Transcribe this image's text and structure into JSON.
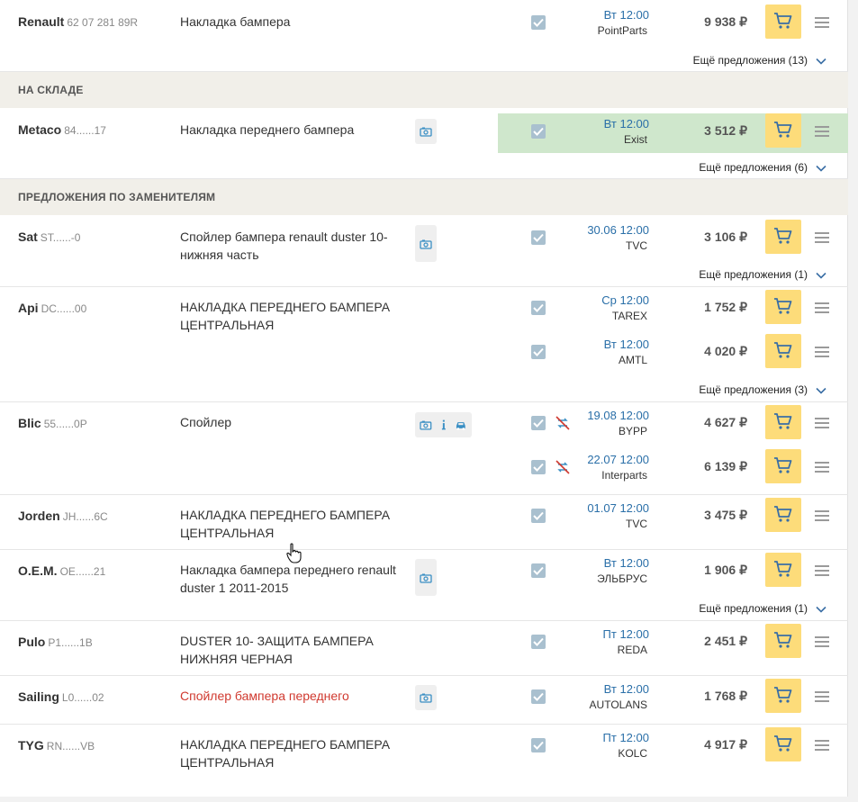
{
  "sections": {
    "in_stock": "НА СКЛАДЕ",
    "substitutes": "ПРЕДЛОЖЕНИЯ ПО ЗАМЕНИТЕЛЯМ"
  },
  "more_label_prefix": "Ещё предложения",
  "products": [
    {
      "brand": "Renault",
      "code": "62 07 281 89R",
      "desc": "Накладка бампера",
      "more": "Ещё предложения (13)",
      "offers": [
        {
          "date": "Вт 12:00",
          "supplier": "PointParts",
          "price": "9 938 ₽"
        }
      ]
    },
    {
      "brand": "Metaco",
      "code": "84......17",
      "desc": "Накладка переднего бампера",
      "more": "Ещё предложения (6)",
      "offers": [
        {
          "date": "Вт 12:00",
          "supplier": "Exist",
          "price": "3 512 ₽"
        }
      ]
    },
    {
      "brand": "Sat",
      "code": "ST......-0",
      "desc": "Спойлер бампера renault duster 10- нижняя часть",
      "more": "Ещё предложения (1)",
      "offers": [
        {
          "date": "30.06 12:00",
          "supplier": "TVC",
          "price": "3 106 ₽"
        }
      ]
    },
    {
      "brand": "Api",
      "code": "DC......00",
      "desc": "НАКЛАДКА ПЕРЕДНЕГО БАМПЕРА ЦЕНТРАЛЬНАЯ",
      "more": "Ещё предложения (3)",
      "offers": [
        {
          "date": "Ср 12:00",
          "supplier": "TAREX",
          "price": "1 752 ₽"
        },
        {
          "date": "Вт 12:00",
          "supplier": "AMTL",
          "price": "4 020 ₽"
        }
      ]
    },
    {
      "brand": "Blic",
      "code": "55......0P",
      "desc": "Спойлер",
      "offers": [
        {
          "date": "19.08 12:00",
          "supplier": "BYPP",
          "price": "4 627 ₽"
        },
        {
          "date": "22.07 12:00",
          "supplier": "Interparts",
          "price": "6 139 ₽"
        }
      ]
    },
    {
      "brand": "Jorden",
      "code": "JH......6C",
      "desc": "НАКЛАДКА ПЕРЕДНЕГО БАМПЕРА ЦЕНТРАЛЬНАЯ",
      "offers": [
        {
          "date": "01.07 12:00",
          "supplier": "TVC",
          "price": "3 475 ₽"
        }
      ]
    },
    {
      "brand": "O.E.M.",
      "code": "OE......21",
      "desc": "Накладка бампера переднего renault duster 1 2011-2015",
      "more": "Ещё предложения (1)",
      "offers": [
        {
          "date": "Вт 12:00",
          "supplier": "ЭЛЬБРУС",
          "price": "1 906 ₽"
        }
      ]
    },
    {
      "brand": "Pulo",
      "code": "P1......1B",
      "desc": "DUSTER 10- ЗАЩИТА БАМПЕРА НИЖНЯЯ ЧЕРНАЯ",
      "offers": [
        {
          "date": "Пт 12:00",
          "supplier": "REDA",
          "price": "2 451 ₽"
        }
      ]
    },
    {
      "brand": "Sailing",
      "code": "L0......02",
      "desc": "Спойлер бампера переднего",
      "offers": [
        {
          "date": "Вт 12:00",
          "supplier": "AUTOLANS",
          "price": "1 768 ₽"
        }
      ]
    },
    {
      "brand": "TYG",
      "code": "RN......VB",
      "desc": "НАКЛАДКА ПЕРЕДНЕГО БАМПЕРА ЦЕНТРАЛЬНАЯ",
      "offers": [
        {
          "date": "Пт 12:00",
          "supplier": "KOLC",
          "price": "4 917 ₽"
        }
      ]
    }
  ],
  "icons": {
    "photo": "camera-icon",
    "info": "info-icon",
    "car": "car-icon",
    "cart": "cart-icon",
    "menu": "menu-icon",
    "chevron": "chevron-down-icon",
    "no_return": "no-return-icon"
  },
  "colors": {
    "cart_button": "#fddc7a",
    "highlight": "#cfe7cc",
    "section_bg": "#f1efe9",
    "date": "#2a6fa8",
    "red_desc": "#d0392f"
  }
}
